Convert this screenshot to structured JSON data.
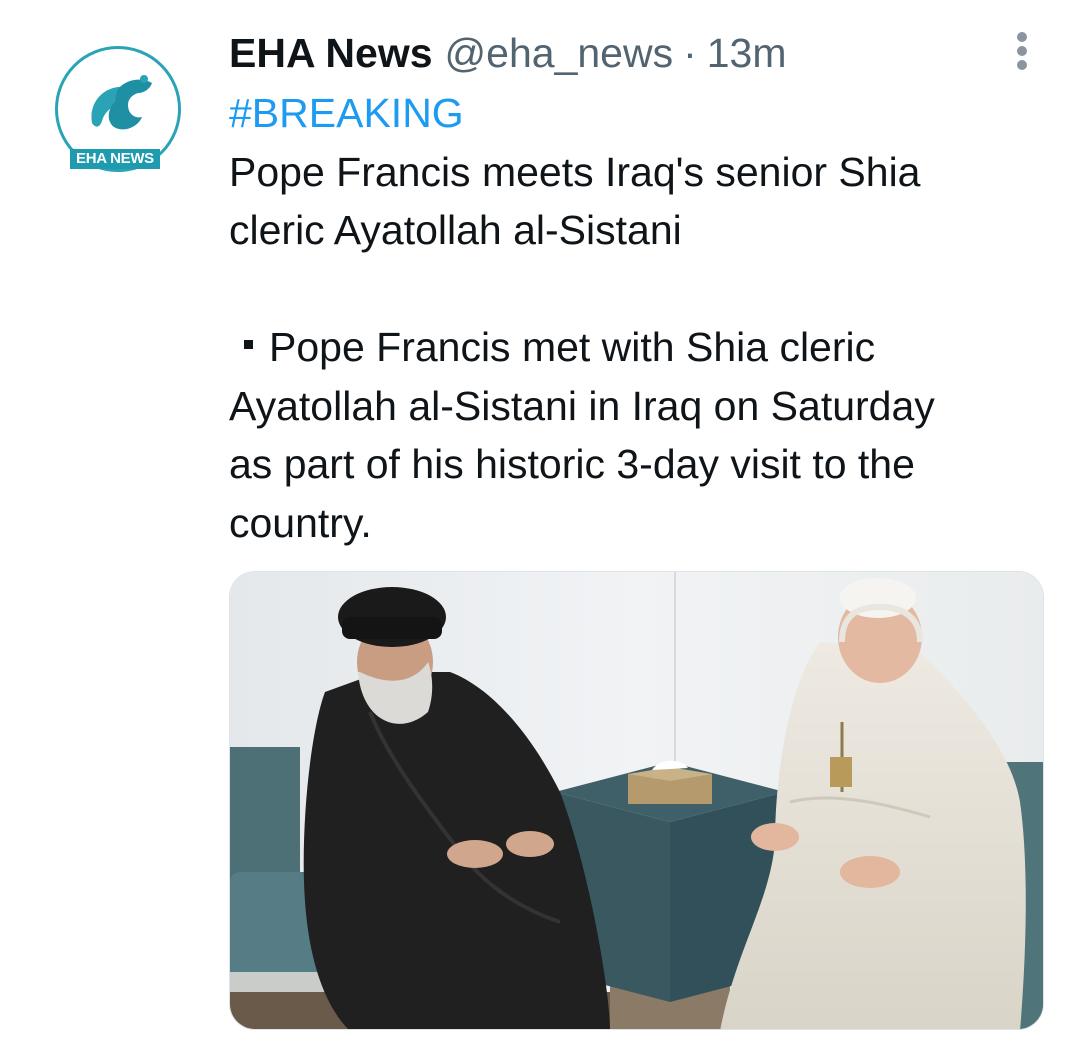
{
  "tweet": {
    "author": {
      "avatar_text": "EHA NEWS",
      "display_name": "EHA News",
      "handle": "@eha_news",
      "separator": "·",
      "time": "13m"
    },
    "hashtag": "#BREAKING",
    "headline_lines": [
      "Pope Francis meets Iraq's senior Shia",
      "cleric Ayatollah al-Sistani"
    ],
    "detail_lines": [
      "Pope Francis met with Shia cleric",
      "Ayatollah al-Sistani in Iraq on Saturday",
      "as part of his historic 3-day visit to the",
      "country."
    ],
    "icons": {
      "more": "more-vertical-icon",
      "bullet": "square-bullet-icon"
    },
    "colors": {
      "brand_teal": "#2aa3b6",
      "hashtag_blue": "#1d9bf0",
      "secondary_text": "#536471"
    }
  }
}
